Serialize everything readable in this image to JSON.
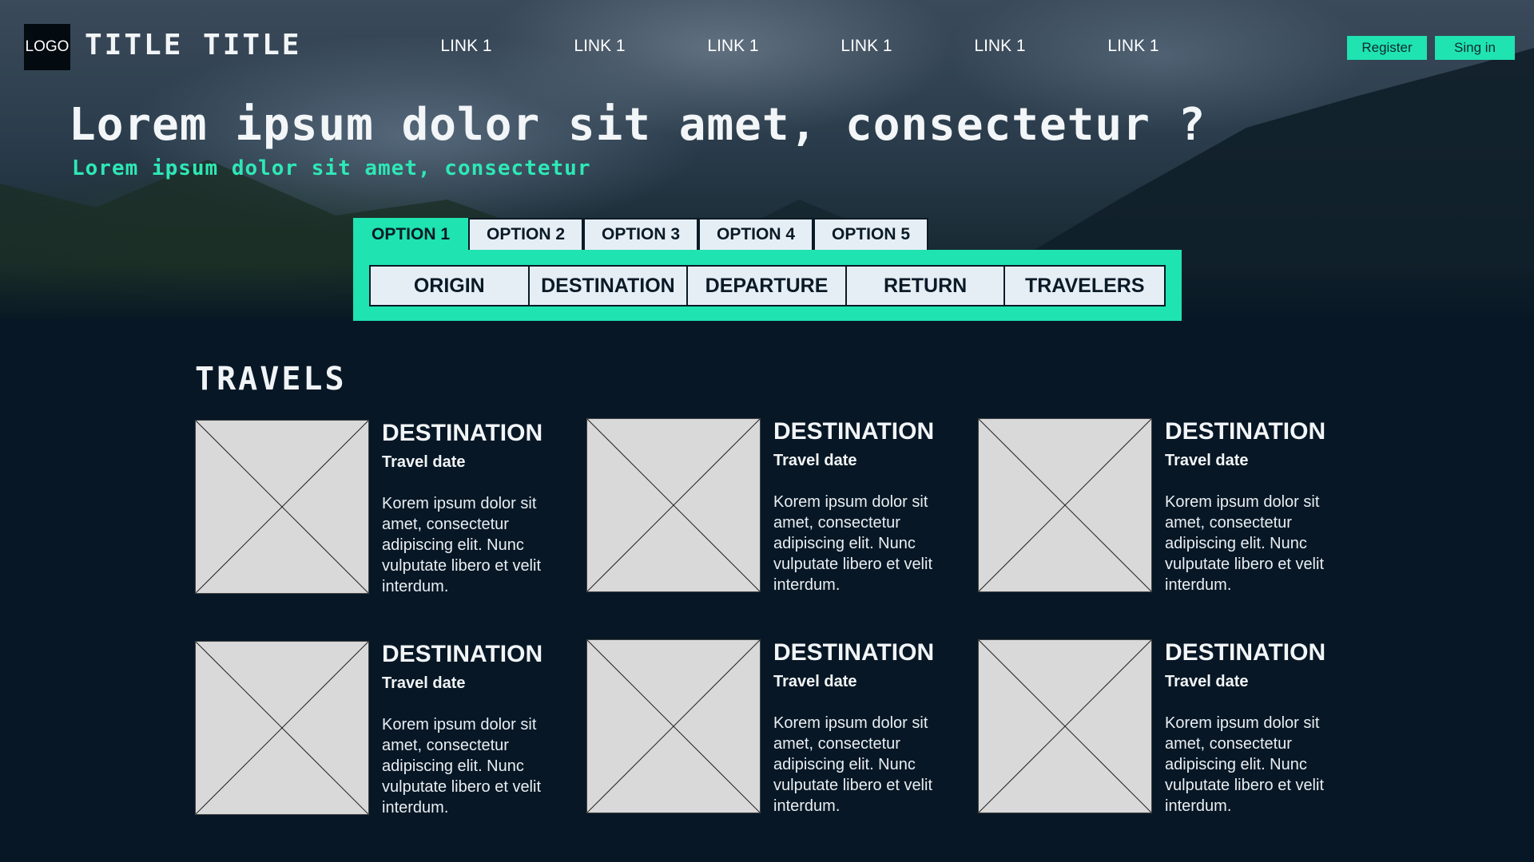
{
  "header": {
    "logo": "LOGO",
    "title": "TITLE TITLE",
    "nav": [
      "LINK 1",
      "LINK 1",
      "LINK 1",
      "LINK 1",
      "LINK 1",
      "LINK 1"
    ],
    "register_label": "Register",
    "signin_label": "Sing in"
  },
  "hero": {
    "headline": "Lorem ipsum dolor sit amet, consectetur ?",
    "subheadline": "Lorem ipsum dolor sit amet, consectetur"
  },
  "search": {
    "tabs": [
      "OPTION 1",
      "OPTION 2",
      "OPTION 3",
      "OPTION 4",
      "OPTION 5"
    ],
    "active_tab": "OPTION 1",
    "fields": [
      "ORIGIN",
      "DESTINATION",
      "DEPARTURE",
      "RETURN",
      "TRAVELERS"
    ]
  },
  "travels": {
    "title": "TRAVELS",
    "cards": [
      {
        "destination": "DESTINATION",
        "date": "Travel date",
        "description": "Korem ipsum dolor sit amet, consectetur adipiscing elit. Nunc vulputate libero et velit interdum."
      },
      {
        "destination": "DESTINATION",
        "date": "Travel date",
        "description": "Korem ipsum dolor sit amet, consectetur adipiscing elit. Nunc vulputate libero et velit interdum."
      },
      {
        "destination": "DESTINATION",
        "date": "Travel date",
        "description": "Korem ipsum dolor sit amet, consectetur adipiscing elit. Nunc vulputate libero et velit interdum."
      },
      {
        "destination": "DESTINATION",
        "date": "Travel date",
        "description": "Korem ipsum dolor sit amet, consectetur adipiscing elit. Nunc vulputate libero et velit interdum."
      },
      {
        "destination": "DESTINATION",
        "date": "Travel date",
        "description": "Korem ipsum dolor sit amet, consectetur adipiscing elit. Nunc vulputate libero et velit interdum."
      },
      {
        "destination": "DESTINATION",
        "date": "Travel date",
        "description": "Korem ipsum dolor sit amet, consectetur adipiscing elit. Nunc vulputate libero et velit interdum."
      }
    ]
  },
  "colors": {
    "accent": "#1fe3b0",
    "background": "#071725",
    "field_bg": "#e6eef5",
    "placeholder_image": "#d9d9d9"
  }
}
